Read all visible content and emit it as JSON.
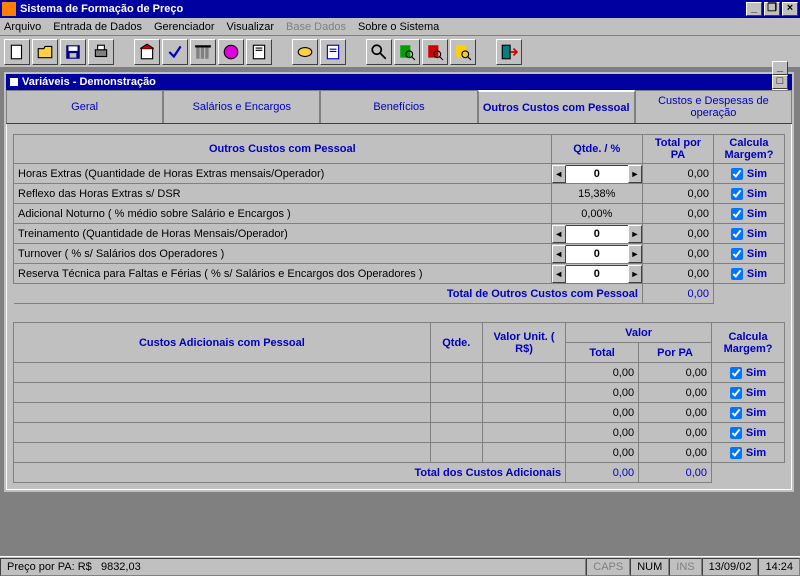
{
  "window": {
    "title": "Sistema de Formação de Preço"
  },
  "menu": {
    "arquivo": "Arquivo",
    "entrada": "Entrada de Dados",
    "gerenciador": "Gerenciador",
    "visualizar": "Visualizar",
    "base": "Base Dados",
    "sobre": "Sobre o Sistema"
  },
  "child": {
    "title": "Variáveis - Demonstração"
  },
  "tabs": {
    "geral": "Geral",
    "salarios": "Salários e Encargos",
    "beneficios": "Benefícios",
    "outros": "Outros Custos com Pessoal",
    "despesas": "Custos e Despesas de operação"
  },
  "headers": {
    "outros": "Outros Custos com Pessoal",
    "qtde": "Qtde. / %",
    "total_pa": "Total por PA",
    "calcula": "Calcula Margem?",
    "adicionais": "Custos Adicionais com Pessoal",
    "qtde2": "Qtde.",
    "valor_unit": "Valor Unit. ( R$)",
    "valor": "Valor",
    "total": "Total",
    "por_pa": "Por PA"
  },
  "rows": [
    {
      "desc": "Horas Extras (Quantidade de Horas Extras mensais/Operador)",
      "spin": "0",
      "total": "0,00",
      "sim": "Sim"
    },
    {
      "desc": "Reflexo das Horas Extras s/ DSR",
      "pct": "15,38%",
      "total": "0,00",
      "sim": "Sim"
    },
    {
      "desc": "Adicional Noturno ( % médio sobre Salário e Encargos )",
      "pct": "0,00%",
      "total": "0,00",
      "sim": "Sim"
    },
    {
      "desc": "Treinamento (Quantidade de Horas Mensais/Operador)",
      "spin": "0",
      "total": "0,00",
      "sim": "Sim"
    },
    {
      "desc": "Turnover ( % s/ Salários dos Operadores )",
      "spin": "0",
      "total": "0,00",
      "sim": "Sim"
    },
    {
      "desc": "Reserva Técnica para Faltas e Férias ( % s/ Salários e Encargos  dos Operadores )",
      "spin": "0",
      "total": "0,00",
      "sim": "Sim"
    }
  ],
  "totals": {
    "outros_lbl": "Total de Outros Custos com Pessoal",
    "outros_val": "0,00",
    "adic_lbl": "Total dos Custos Adicionais",
    "adic_total": "0,00",
    "adic_pa": "0,00"
  },
  "blank": {
    "total": "0,00",
    "pa": "0,00",
    "sim": "Sim"
  },
  "status": {
    "price_lbl": "Preço por PA:  R$",
    "price_val": "9832,03",
    "caps": "CAPS",
    "num": "NUM",
    "ins": "INS",
    "date": "13/09/02",
    "time": "14:24"
  }
}
